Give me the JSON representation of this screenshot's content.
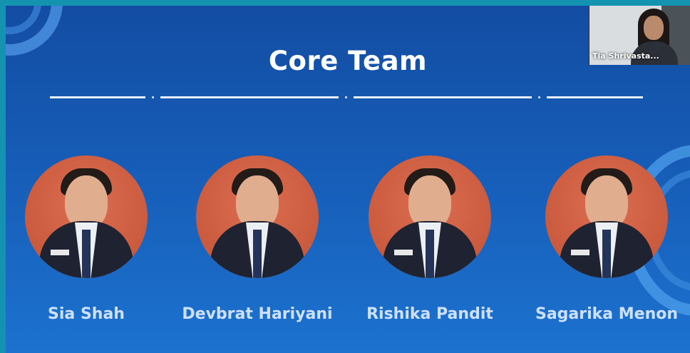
{
  "slide": {
    "title": "Core Team",
    "members": [
      {
        "name": "Sia Shah"
      },
      {
        "name": "Devbrat Hariyani"
      },
      {
        "name": "Rishika Pandit"
      },
      {
        "name": "Sagarika Menon"
      }
    ]
  },
  "video": {
    "participant_name": "Tia Shrivasta..."
  },
  "colors": {
    "frame": "#1493b0",
    "slide_bg": "#165cb6",
    "photo_bg": "#c95a3e",
    "name_text": "#cde0ff"
  }
}
